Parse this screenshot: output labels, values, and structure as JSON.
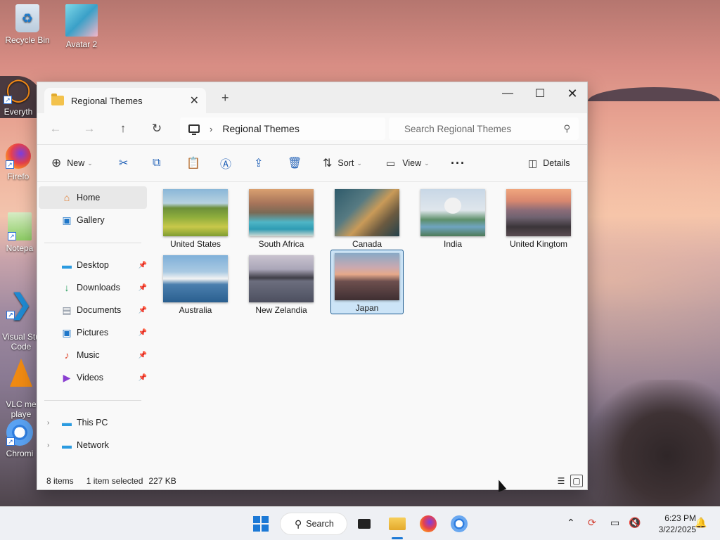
{
  "desktop": {
    "icons": [
      {
        "label": "Recycle Bin"
      },
      {
        "label": "Avatar 2"
      },
      {
        "label": "Everyth"
      },
      {
        "label": "Firefo"
      },
      {
        "label": "Notepa"
      },
      {
        "label": "Visual Stu\nCode"
      },
      {
        "label": "VLC me\nplaye"
      },
      {
        "label": "Chromi"
      }
    ]
  },
  "window": {
    "tab_title": "Regional Themes",
    "address": {
      "crumb": "Regional Themes"
    },
    "search": {
      "placeholder": "Search Regional Themes"
    },
    "toolbar": {
      "new_label": "New",
      "sort_label": "Sort",
      "view_label": "View",
      "more_label": "···",
      "details_label": "Details"
    },
    "sidebar": {
      "top": [
        {
          "label": "Home"
        },
        {
          "label": "Gallery"
        }
      ],
      "quick": [
        {
          "label": "Desktop"
        },
        {
          "label": "Downloads"
        },
        {
          "label": "Documents"
        },
        {
          "label": "Pictures"
        },
        {
          "label": "Music"
        },
        {
          "label": "Videos"
        }
      ],
      "bottom": [
        {
          "label": "This PC"
        },
        {
          "label": "Network"
        }
      ]
    },
    "files": [
      {
        "name": "United States"
      },
      {
        "name": "South Africa"
      },
      {
        "name": "Canada"
      },
      {
        "name": "India"
      },
      {
        "name": "United Kingtom"
      },
      {
        "name": "Australia"
      },
      {
        "name": "New Zelandia"
      },
      {
        "name": "Japan"
      }
    ],
    "status": {
      "items": "8 items",
      "selection": "1 item selected",
      "size": "227 KB"
    }
  },
  "taskbar": {
    "search_label": "Search",
    "time": "6:23 PM",
    "date": "3/22/2025"
  }
}
